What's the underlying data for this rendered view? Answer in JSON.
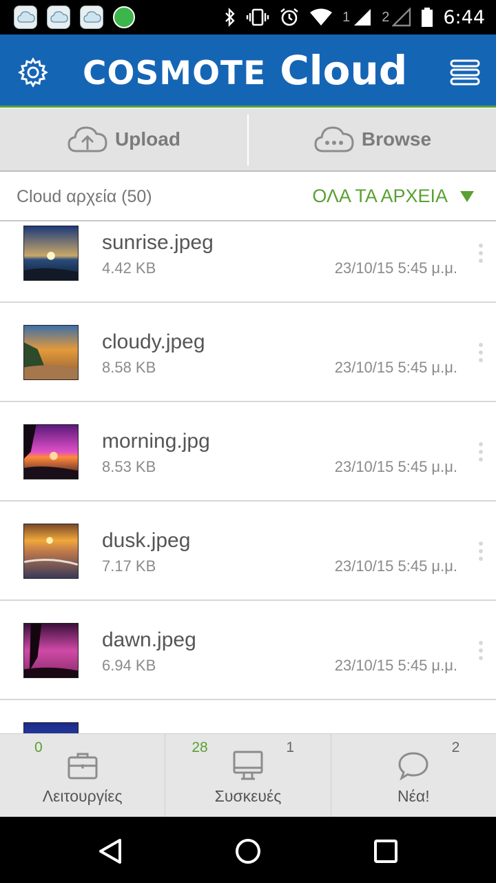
{
  "status_bar": {
    "time": "6:44",
    "sim1": "1",
    "sim2": "2"
  },
  "header": {
    "brand": "COSMOTE",
    "product": "Cloud",
    "colors": {
      "bar": "#1565b5",
      "accent": "#5aa032"
    }
  },
  "actions": {
    "upload_label": "Upload",
    "browse_label": "Browse"
  },
  "filter": {
    "count_label": "Cloud αρχεία (50)",
    "dropdown_label": "ΟΛΑ ΤΑ ΑΡΧΕΙΑ"
  },
  "files": [
    {
      "name": "sunrise.jpeg",
      "size": "4.42 KB",
      "date": "23/10/15 5:45 μ.μ."
    },
    {
      "name": "cloudy.jpeg",
      "size": "8.58 KB",
      "date": "23/10/15 5:45 μ.μ."
    },
    {
      "name": "morning.jpg",
      "size": "8.53 KB",
      "date": "23/10/15 5:45 μ.μ."
    },
    {
      "name": "dusk.jpeg",
      "size": "7.17 KB",
      "date": "23/10/15 5:45 μ.μ."
    },
    {
      "name": "dawn.jpeg",
      "size": "6.94 KB",
      "date": "23/10/15 5:45 μ.μ."
    }
  ],
  "tabs": [
    {
      "label": "Λειτουργίες",
      "badge_green": "0",
      "badge_grey": "",
      "icon": "briefcase-icon"
    },
    {
      "label": "Συσκευές",
      "badge_green": "28",
      "badge_grey": "1",
      "icon": "monitor-icon"
    },
    {
      "label": "Νέα!",
      "badge_green": "",
      "badge_grey": "2",
      "icon": "chat-bubble-icon"
    }
  ]
}
